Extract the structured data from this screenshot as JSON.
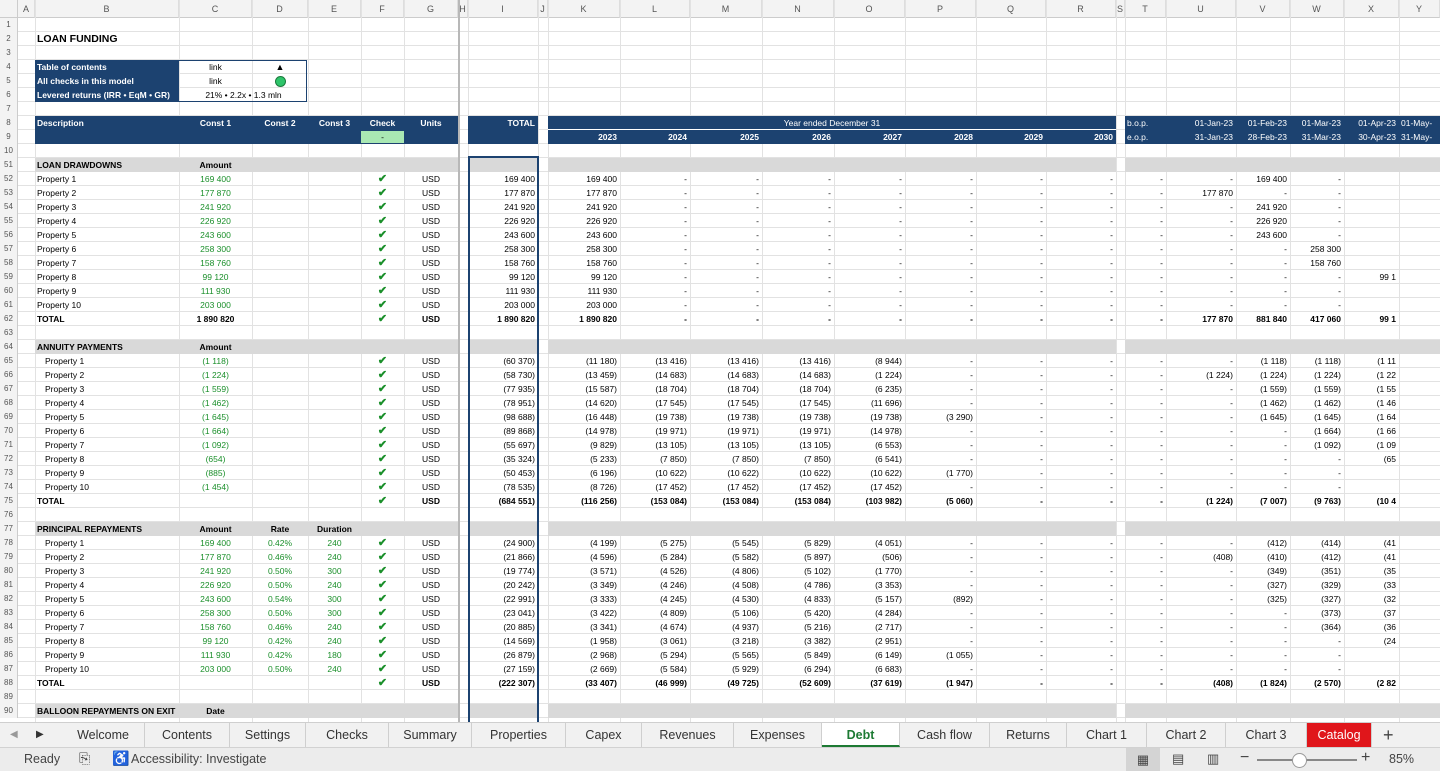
{
  "columns": [
    "A",
    "B",
    "C",
    "D",
    "E",
    "F",
    "G",
    "H",
    "I",
    "J",
    "K",
    "L",
    "M",
    "N",
    "O",
    "P",
    "Q",
    "R",
    "S",
    "T",
    "U",
    "V",
    "W",
    "X",
    "Y"
  ],
  "title": "LOAN FUNDING",
  "toc": {
    "rows": [
      {
        "label": "Table of contents",
        "value": "link",
        "mark": "▲"
      },
      {
        "label": "All checks in this model",
        "value": "link",
        "mark": "●"
      },
      {
        "label": "Levered returns (IRR • EqM • GR)",
        "value": "21% • 2.2x • 1.3 mln",
        "mark": ""
      }
    ]
  },
  "header": {
    "description": "Description",
    "const1": "Const 1",
    "const2": "Const 2",
    "const3": "Const 3",
    "check": "Check",
    "check_value": "-",
    "units": "Units",
    "total": "TOTAL",
    "year_group": "Year ended December 31",
    "years": [
      "2023",
      "2024",
      "2025",
      "2026",
      "2027",
      "2028",
      "2029",
      "2030"
    ],
    "bop": "b.o.p.",
    "eop": "e.o.p.",
    "months_start": [
      "01-Jan-23",
      "01-Feb-23",
      "01-Mar-23",
      "01-Apr-23",
      "01-May-"
    ],
    "months_end": [
      "31-Jan-23",
      "28-Feb-23",
      "31-Mar-23",
      "30-Apr-23",
      "31-May-"
    ]
  },
  "sections": [
    {
      "row": "51",
      "title": "LOAN DRAWDOWNS",
      "c1": "Amount",
      "c2": "",
      "c3": "",
      "rows": [
        {
          "n": "52",
          "label": "Property 1",
          "c1": "169 400",
          "c2": "",
          "c3": "",
          "unit": "USD",
          "total": "169 400",
          "years": [
            "169 400",
            "-",
            "-",
            "-",
            "-",
            "-",
            "-",
            "-"
          ],
          "months": [
            "-",
            "-",
            "169 400",
            "-",
            ""
          ]
        },
        {
          "n": "53",
          "label": "Property 2",
          "c1": "177 870",
          "c2": "",
          "c3": "",
          "unit": "USD",
          "total": "177 870",
          "years": [
            "177 870",
            "-",
            "-",
            "-",
            "-",
            "-",
            "-",
            "-"
          ],
          "months": [
            "-",
            "177 870",
            "-",
            "-",
            ""
          ]
        },
        {
          "n": "54",
          "label": "Property 3",
          "c1": "241 920",
          "c2": "",
          "c3": "",
          "unit": "USD",
          "total": "241 920",
          "years": [
            "241 920",
            "-",
            "-",
            "-",
            "-",
            "-",
            "-",
            "-"
          ],
          "months": [
            "-",
            "-",
            "241 920",
            "-",
            ""
          ]
        },
        {
          "n": "55",
          "label": "Property 4",
          "c1": "226 920",
          "c2": "",
          "c3": "",
          "unit": "USD",
          "total": "226 920",
          "years": [
            "226 920",
            "-",
            "-",
            "-",
            "-",
            "-",
            "-",
            "-"
          ],
          "months": [
            "-",
            "-",
            "226 920",
            "-",
            ""
          ]
        },
        {
          "n": "56",
          "label": "Property 5",
          "c1": "243 600",
          "c2": "",
          "c3": "",
          "unit": "USD",
          "total": "243 600",
          "years": [
            "243 600",
            "-",
            "-",
            "-",
            "-",
            "-",
            "-",
            "-"
          ],
          "months": [
            "-",
            "-",
            "243 600",
            "-",
            ""
          ]
        },
        {
          "n": "57",
          "label": "Property 6",
          "c1": "258 300",
          "c2": "",
          "c3": "",
          "unit": "USD",
          "total": "258 300",
          "years": [
            "258 300",
            "-",
            "-",
            "-",
            "-",
            "-",
            "-",
            "-"
          ],
          "months": [
            "-",
            "-",
            "-",
            "258 300",
            ""
          ]
        },
        {
          "n": "58",
          "label": "Property 7",
          "c1": "158 760",
          "c2": "",
          "c3": "",
          "unit": "USD",
          "total": "158 760",
          "years": [
            "158 760",
            "-",
            "-",
            "-",
            "-",
            "-",
            "-",
            "-"
          ],
          "months": [
            "-",
            "-",
            "-",
            "158 760",
            ""
          ]
        },
        {
          "n": "59",
          "label": "Property 8",
          "c1": "99 120",
          "c2": "",
          "c3": "",
          "unit": "USD",
          "total": "99 120",
          "years": [
            "99 120",
            "-",
            "-",
            "-",
            "-",
            "-",
            "-",
            "-"
          ],
          "months": [
            "-",
            "-",
            "-",
            "-",
            "99 1"
          ]
        },
        {
          "n": "60",
          "label": "Property 9",
          "c1": "111 930",
          "c2": "",
          "c3": "",
          "unit": "USD",
          "total": "111 930",
          "years": [
            "111 930",
            "-",
            "-",
            "-",
            "-",
            "-",
            "-",
            "-"
          ],
          "months": [
            "-",
            "-",
            "-",
            "-",
            ""
          ]
        },
        {
          "n": "61",
          "label": "Property 10",
          "c1": "203 000",
          "c2": "",
          "c3": "",
          "unit": "USD",
          "total": "203 000",
          "years": [
            "203 000",
            "-",
            "-",
            "-",
            "-",
            "-",
            "-",
            "-"
          ],
          "months": [
            "-",
            "-",
            "-",
            "-",
            ""
          ]
        }
      ],
      "total": {
        "n": "62",
        "label": "TOTAL",
        "c1": "1 890 820",
        "unit": "USD",
        "total": "1 890 820",
        "years": [
          "1 890 820",
          "-",
          "-",
          "-",
          "-",
          "-",
          "-",
          "-"
        ],
        "months": [
          "-",
          "177 870",
          "881 840",
          "417 060",
          "99 1"
        ]
      }
    },
    {
      "row": "64",
      "title": "ANNUITY PAYMENTS",
      "c1": "Amount",
      "c2": "",
      "c3": "",
      "rows": [
        {
          "n": "65",
          "label": "Property 1",
          "c1": "(1 118)",
          "c2": "",
          "c3": "",
          "unit": "USD",
          "total": "(60 370)",
          "years": [
            "(11 180)",
            "(13 416)",
            "(13 416)",
            "(13 416)",
            "(8 944)",
            "-",
            "-",
            "-"
          ],
          "months": [
            "-",
            "-",
            "(1 118)",
            "(1 118)",
            "(1 11"
          ]
        },
        {
          "n": "66",
          "label": "Property 2",
          "c1": "(1 224)",
          "c2": "",
          "c3": "",
          "unit": "USD",
          "total": "(58 730)",
          "years": [
            "(13 459)",
            "(14 683)",
            "(14 683)",
            "(14 683)",
            "(1 224)",
            "-",
            "-",
            "-"
          ],
          "months": [
            "-",
            "(1 224)",
            "(1 224)",
            "(1 224)",
            "(1 22"
          ]
        },
        {
          "n": "67",
          "label": "Property 3",
          "c1": "(1 559)",
          "c2": "",
          "c3": "",
          "unit": "USD",
          "total": "(77 935)",
          "years": [
            "(15 587)",
            "(18 704)",
            "(18 704)",
            "(18 704)",
            "(6 235)",
            "-",
            "-",
            "-"
          ],
          "months": [
            "-",
            "-",
            "(1 559)",
            "(1 559)",
            "(1 55"
          ]
        },
        {
          "n": "68",
          "label": "Property 4",
          "c1": "(1 462)",
          "c2": "",
          "c3": "",
          "unit": "USD",
          "total": "(78 951)",
          "years": [
            "(14 620)",
            "(17 545)",
            "(17 545)",
            "(17 545)",
            "(11 696)",
            "-",
            "-",
            "-"
          ],
          "months": [
            "-",
            "-",
            "(1 462)",
            "(1 462)",
            "(1 46"
          ]
        },
        {
          "n": "69",
          "label": "Property 5",
          "c1": "(1 645)",
          "c2": "",
          "c3": "",
          "unit": "USD",
          "total": "(98 688)",
          "years": [
            "(16 448)",
            "(19 738)",
            "(19 738)",
            "(19 738)",
            "(19 738)",
            "(3 290)",
            "-",
            "-"
          ],
          "months": [
            "-",
            "-",
            "(1 645)",
            "(1 645)",
            "(1 64"
          ]
        },
        {
          "n": "70",
          "label": "Property 6",
          "c1": "(1 664)",
          "c2": "",
          "c3": "",
          "unit": "USD",
          "total": "(89 868)",
          "years": [
            "(14 978)",
            "(19 971)",
            "(19 971)",
            "(19 971)",
            "(14 978)",
            "-",
            "-",
            "-"
          ],
          "months": [
            "-",
            "-",
            "-",
            "(1 664)",
            "(1 66"
          ]
        },
        {
          "n": "71",
          "label": "Property 7",
          "c1": "(1 092)",
          "c2": "",
          "c3": "",
          "unit": "USD",
          "total": "(55 697)",
          "years": [
            "(9 829)",
            "(13 105)",
            "(13 105)",
            "(13 105)",
            "(6 553)",
            "-",
            "-",
            "-"
          ],
          "months": [
            "-",
            "-",
            "-",
            "(1 092)",
            "(1 09"
          ]
        },
        {
          "n": "72",
          "label": "Property 8",
          "c1": "(654)",
          "c2": "",
          "c3": "",
          "unit": "USD",
          "total": "(35 324)",
          "years": [
            "(5 233)",
            "(7 850)",
            "(7 850)",
            "(7 850)",
            "(6 541)",
            "-",
            "-",
            "-"
          ],
          "months": [
            "-",
            "-",
            "-",
            "-",
            "(65"
          ]
        },
        {
          "n": "73",
          "label": "Property 9",
          "c1": "(885)",
          "c2": "",
          "c3": "",
          "unit": "USD",
          "total": "(50 453)",
          "years": [
            "(6 196)",
            "(10 622)",
            "(10 622)",
            "(10 622)",
            "(10 622)",
            "(1 770)",
            "-",
            "-"
          ],
          "months": [
            "-",
            "-",
            "-",
            "-",
            ""
          ]
        },
        {
          "n": "74",
          "label": "Property 10",
          "c1": "(1 454)",
          "c2": "",
          "c3": "",
          "unit": "USD",
          "total": "(78 535)",
          "years": [
            "(8 726)",
            "(17 452)",
            "(17 452)",
            "(17 452)",
            "(17 452)",
            "-",
            "-",
            "-"
          ],
          "months": [
            "-",
            "-",
            "-",
            "-",
            ""
          ]
        }
      ],
      "total": {
        "n": "75",
        "label": "TOTAL",
        "c1": "",
        "unit": "USD",
        "total": "(684 551)",
        "years": [
          "(116 256)",
          "(153 084)",
          "(153 084)",
          "(153 084)",
          "(103 982)",
          "(5 060)",
          "-",
          "-"
        ],
        "months": [
          "-",
          "(1 224)",
          "(7 007)",
          "(9 763)",
          "(10 4"
        ]
      }
    },
    {
      "row": "77",
      "title": "PRINCIPAL REPAYMENTS",
      "c1": "Amount",
      "c2": "Rate",
      "c3": "Duration",
      "rows": [
        {
          "n": "78",
          "label": "Property 1",
          "c1": "169 400",
          "c2": "0.42%",
          "c3": "240",
          "unit": "USD",
          "total": "(24 900)",
          "years": [
            "(4 199)",
            "(5 275)",
            "(5 545)",
            "(5 829)",
            "(4 051)",
            "-",
            "-",
            "-"
          ],
          "months": [
            "-",
            "-",
            "(412)",
            "(414)",
            "(41"
          ]
        },
        {
          "n": "79",
          "label": "Property 2",
          "c1": "177 870",
          "c2": "0.46%",
          "c3": "240",
          "unit": "USD",
          "total": "(21 866)",
          "years": [
            "(4 596)",
            "(5 284)",
            "(5 582)",
            "(5 897)",
            "(506)",
            "-",
            "-",
            "-"
          ],
          "months": [
            "-",
            "(408)",
            "(410)",
            "(412)",
            "(41"
          ]
        },
        {
          "n": "80",
          "label": "Property 3",
          "c1": "241 920",
          "c2": "0.50%",
          "c3": "300",
          "unit": "USD",
          "total": "(19 774)",
          "years": [
            "(3 571)",
            "(4 526)",
            "(4 806)",
            "(5 102)",
            "(1 770)",
            "-",
            "-",
            "-"
          ],
          "months": [
            "-",
            "-",
            "(349)",
            "(351)",
            "(35"
          ]
        },
        {
          "n": "81",
          "label": "Property 4",
          "c1": "226 920",
          "c2": "0.50%",
          "c3": "240",
          "unit": "USD",
          "total": "(20 242)",
          "years": [
            "(3 349)",
            "(4 246)",
            "(4 508)",
            "(4 786)",
            "(3 353)",
            "-",
            "-",
            "-"
          ],
          "months": [
            "-",
            "-",
            "(327)",
            "(329)",
            "(33"
          ]
        },
        {
          "n": "82",
          "label": "Property 5",
          "c1": "243 600",
          "c2": "0.54%",
          "c3": "300",
          "unit": "USD",
          "total": "(22 991)",
          "years": [
            "(3 333)",
            "(4 245)",
            "(4 530)",
            "(4 833)",
            "(5 157)",
            "(892)",
            "-",
            "-"
          ],
          "months": [
            "-",
            "-",
            "(325)",
            "(327)",
            "(32"
          ]
        },
        {
          "n": "83",
          "label": "Property 6",
          "c1": "258 300",
          "c2": "0.50%",
          "c3": "300",
          "unit": "USD",
          "total": "(23 041)",
          "years": [
            "(3 422)",
            "(4 809)",
            "(5 106)",
            "(5 420)",
            "(4 284)",
            "-",
            "-",
            "-"
          ],
          "months": [
            "-",
            "-",
            "-",
            "(373)",
            "(37"
          ]
        },
        {
          "n": "84",
          "label": "Property 7",
          "c1": "158 760",
          "c2": "0.46%",
          "c3": "240",
          "unit": "USD",
          "total": "(20 885)",
          "years": [
            "(3 341)",
            "(4 674)",
            "(4 937)",
            "(5 216)",
            "(2 717)",
            "-",
            "-",
            "-"
          ],
          "months": [
            "-",
            "-",
            "-",
            "(364)",
            "(36"
          ]
        },
        {
          "n": "85",
          "label": "Property 8",
          "c1": "99 120",
          "c2": "0.42%",
          "c3": "240",
          "unit": "USD",
          "total": "(14 569)",
          "years": [
            "(1 958)",
            "(3 061)",
            "(3 218)",
            "(3 382)",
            "(2 951)",
            "-",
            "-",
            "-"
          ],
          "months": [
            "-",
            "-",
            "-",
            "-",
            "(24"
          ]
        },
        {
          "n": "86",
          "label": "Property 9",
          "c1": "111 930",
          "c2": "0.42%",
          "c3": "180",
          "unit": "USD",
          "total": "(26 879)",
          "years": [
            "(2 968)",
            "(5 294)",
            "(5 565)",
            "(5 849)",
            "(6 149)",
            "(1 055)",
            "-",
            "-"
          ],
          "months": [
            "-",
            "-",
            "-",
            "-",
            ""
          ]
        },
        {
          "n": "87",
          "label": "Property 10",
          "c1": "203 000",
          "c2": "0.50%",
          "c3": "240",
          "unit": "USD",
          "total": "(27 159)",
          "years": [
            "(2 669)",
            "(5 584)",
            "(5 929)",
            "(6 294)",
            "(6 683)",
            "-",
            "-",
            "-"
          ],
          "months": [
            "-",
            "-",
            "-",
            "-",
            ""
          ]
        }
      ],
      "total": {
        "n": "88",
        "label": "TOTAL",
        "c1": "",
        "unit": "USD",
        "total": "(222 307)",
        "years": [
          "(33 407)",
          "(46 999)",
          "(49 725)",
          "(52 609)",
          "(37 619)",
          "(1 947)",
          "-",
          "-"
        ],
        "months": [
          "-",
          "(408)",
          "(1 824)",
          "(2 570)",
          "(2 82"
        ]
      }
    },
    {
      "row": "90",
      "title": "BALLOON REPAYMENTS ON EXIT",
      "c1": "Date",
      "c2": "",
      "c3": "",
      "rows": []
    }
  ],
  "tabs": [
    "Welcome",
    "Contents",
    "Settings",
    "Checks",
    "Summary",
    "Properties",
    "Capex",
    "Revenues",
    "Expenses",
    "Debt",
    "Cash flow",
    "Returns",
    "Chart 1",
    "Chart 2",
    "Chart 3",
    "Catalog"
  ],
  "active_tab": "Debt",
  "status": {
    "ready": "Ready",
    "accessibility": "Accessibility: Investigate",
    "zoom": "85%"
  },
  "colors": {
    "header_blue": "#1c4270",
    "check_green": "#1a8f2a",
    "active_tab": "#1d7a33",
    "catalog_tab": "#e0161b"
  }
}
